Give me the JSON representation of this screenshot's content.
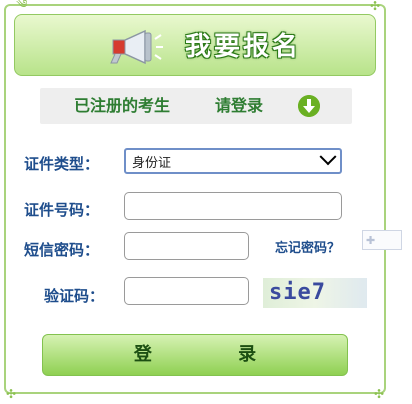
{
  "header": {
    "title": "我要报名",
    "icon": "megaphone-icon"
  },
  "login_bar": {
    "registered": "已注册的考生",
    "please_login": "请登录",
    "icon": "down-arrow-icon"
  },
  "form": {
    "id_type": {
      "label": "证件类型：",
      "value": "身份证"
    },
    "id_number": {
      "label": "证件号码：",
      "value": ""
    },
    "sms_code": {
      "label": "短信密码：",
      "value": ""
    },
    "forgot_link": "忘记密码？",
    "captcha": {
      "label": "验证码：",
      "value": "",
      "image_text": "sie7"
    },
    "submit_label": "登 录"
  },
  "colors": {
    "accent_green": "#8fd052",
    "label_blue": "#1e4d8c"
  }
}
